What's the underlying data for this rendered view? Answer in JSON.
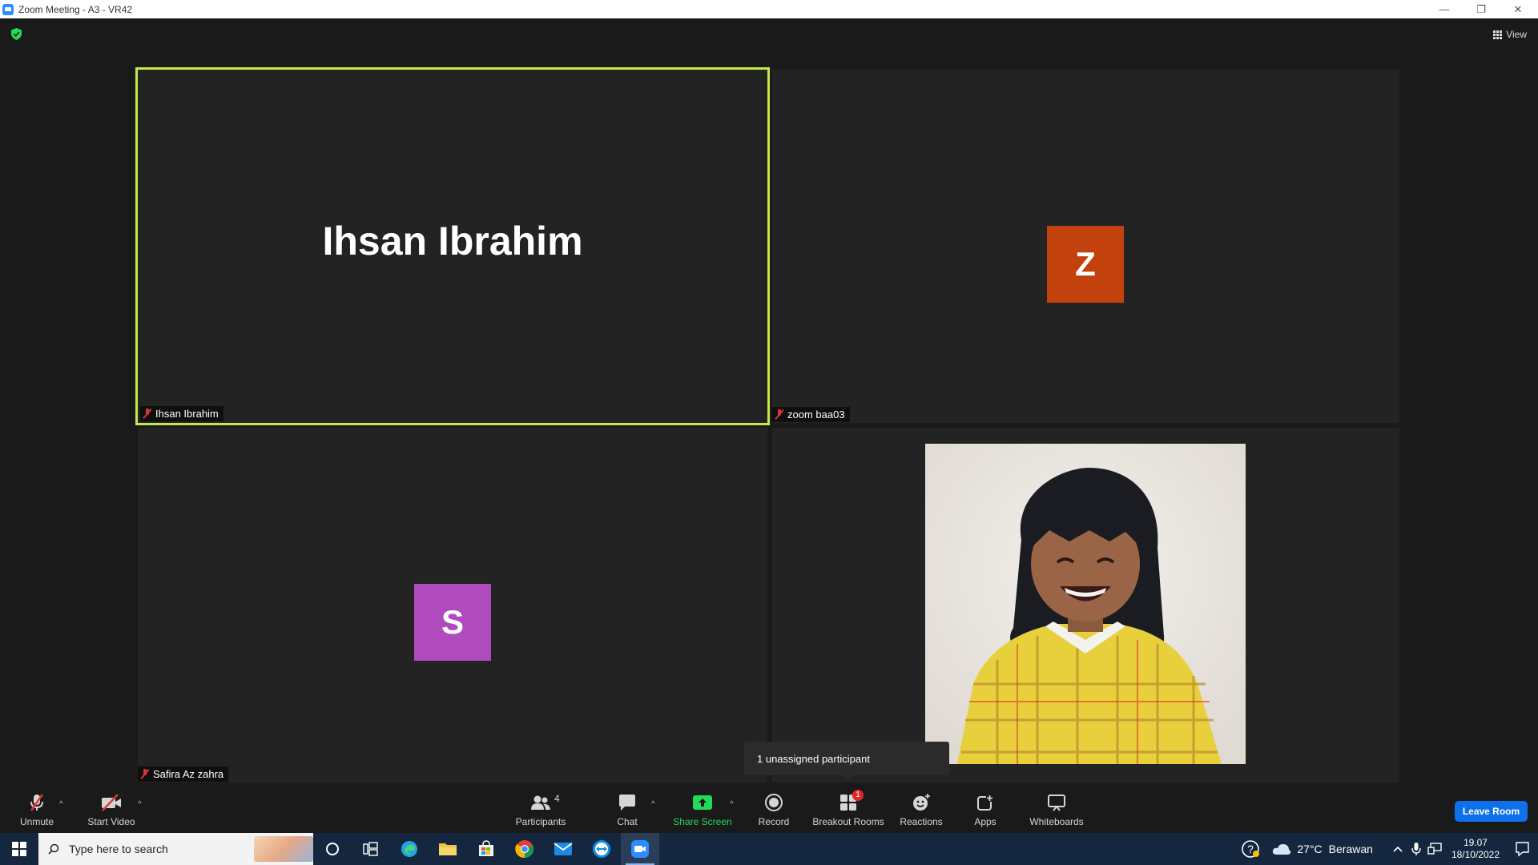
{
  "window": {
    "title": "Zoom Meeting - A3 - VR42",
    "minimize": "—",
    "restore": "❐",
    "close": "✕"
  },
  "meeting": {
    "view_label": "View",
    "tiles": [
      {
        "name": "Ihsan Ibrahim",
        "big_name": "Ihsan Ibrahim",
        "muted": true,
        "active_speaker": true
      },
      {
        "name": "zoom baa03",
        "avatar_letter": "Z",
        "avatar_color": "#c2410c",
        "muted": true
      },
      {
        "name": "Safira Az zahra",
        "avatar_letter": "S",
        "avatar_color": "#b04bbd",
        "muted": true
      },
      {
        "name": "",
        "has_photo": true
      }
    ],
    "tooltip": "1 unassigned participant"
  },
  "toolbar": {
    "unmute": "Unmute",
    "start_video": "Start Video",
    "participants": "Participants",
    "participants_count": "4",
    "chat": "Chat",
    "share_screen": "Share Screen",
    "record": "Record",
    "breakout_rooms": "Breakout Rooms",
    "breakout_badge": "1",
    "reactions": "Reactions",
    "apps": "Apps",
    "whiteboards": "Whiteboards",
    "leave_room": "Leave Room",
    "colors": {
      "share_green": "#23d959",
      "leave_blue": "#0e71eb",
      "active_border": "#c4e94c"
    }
  },
  "taskbar": {
    "search_placeholder": "Type here to search",
    "weather_temp": "27°C",
    "weather_desc": "Berawan",
    "time": "19.07",
    "date": "18/10/2022"
  }
}
